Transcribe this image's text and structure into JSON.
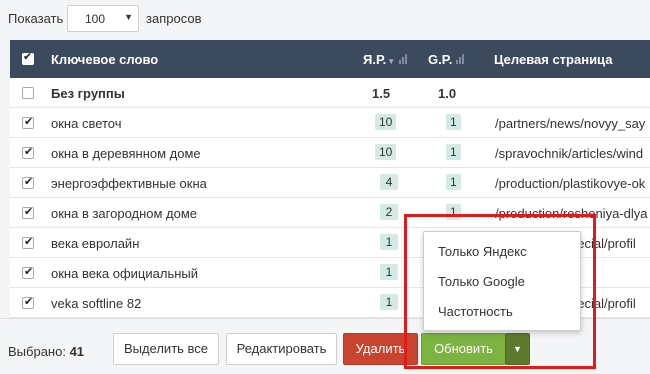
{
  "topbar": {
    "show_label": "Показать",
    "per_page": "100",
    "requests_label": "запросов"
  },
  "table": {
    "headers": {
      "keyword": "Ключевое слово",
      "yandex": "Я.Р.",
      "google": "G.P.",
      "target_page": "Целевая страница"
    },
    "group_row": {
      "keyword": "Без группы",
      "yandex": "1.5",
      "google": "1.0"
    },
    "rows": [
      {
        "keyword": "окна светоч",
        "yandex": "10",
        "google": "1",
        "url": "/partners/news/novyy_say"
      },
      {
        "keyword": "окна в деревянном доме",
        "yandex": "10",
        "google": "1",
        "url": "/spravochnik/articles/wind"
      },
      {
        "keyword": "энергоэффективные окна",
        "yandex": "4",
        "google": "1",
        "url": "/production/plastikovye-ok"
      },
      {
        "keyword": "окна в загородном доме",
        "yandex": "2",
        "google": "1",
        "url": "/production/resheniya-dlya"
      },
      {
        "keyword": "века евролайн",
        "yandex": "1",
        "google": "",
        "url": "pecial/profil"
      },
      {
        "keyword": "окна века официальный",
        "yandex": "1",
        "google": "",
        "url": ""
      },
      {
        "keyword": "veka softline 82",
        "yandex": "1",
        "google": "",
        "url": "pecial/profil"
      }
    ]
  },
  "footer": {
    "selected_label": "Выбрано:",
    "selected_count": "41",
    "select_all": "Выделить все",
    "edit": "Редактировать",
    "delete": "Удалить",
    "update": "Обновить",
    "caret": "▼"
  },
  "dropdown": {
    "items": [
      "Только Яндекс",
      "Только Google",
      "Частотность"
    ]
  },
  "colors": {
    "header_bg": "#3c4a5e",
    "badge_bg": "#d3ebe4",
    "delete": "#c9442f",
    "update": "#7cb342",
    "highlight": "#e01b1b"
  }
}
